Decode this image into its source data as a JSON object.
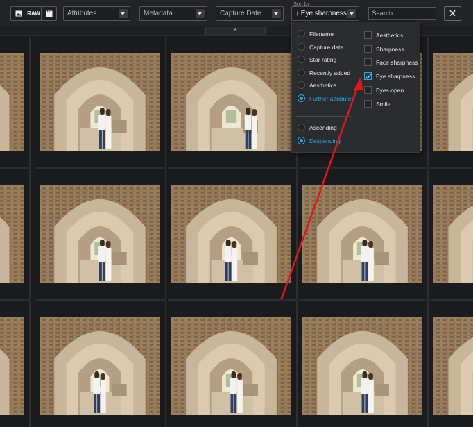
{
  "toolbar": {
    "view_buttons": [
      {
        "name": "image-icon",
        "label": ""
      },
      {
        "name": "raw-button",
        "label": "RAW"
      },
      {
        "name": "film-icon",
        "label": ""
      }
    ],
    "attributes_placeholder": "Attributes",
    "metadata_placeholder": "Metadata",
    "capture_date_label": "Capture Date",
    "sort_by_label": "Sort by",
    "sort_value": "Eye sharpness",
    "sort_direction_icon": "↓",
    "search_placeholder": "Search",
    "close_icon": "✕",
    "collapse_icon": "⌃"
  },
  "sort_menu": {
    "sort_options": [
      {
        "label": "Filename",
        "selected": false
      },
      {
        "label": "Capture date",
        "selected": false
      },
      {
        "label": "Star rating",
        "selected": false
      },
      {
        "label": "Recently added",
        "selected": false
      },
      {
        "label": "Aesthetics",
        "selected": false
      },
      {
        "label": "Further attributes",
        "selected": true
      }
    ],
    "order_options": [
      {
        "label": "Ascending",
        "selected": false
      },
      {
        "label": "Descending",
        "selected": true
      }
    ],
    "attributes": [
      {
        "label": "Aesthetics",
        "checked": false
      },
      {
        "label": "Sharpness",
        "checked": false
      },
      {
        "label": "Face sharpness",
        "checked": false
      },
      {
        "label": "Eye sharpness",
        "checked": true
      },
      {
        "label": "Eyes open",
        "checked": false
      },
      {
        "label": "Smile",
        "checked": false
      }
    ]
  },
  "colors": {
    "accent": "#27a9f0",
    "background": "#1b1c1e",
    "annotation_arrow": "#d81c1c"
  }
}
